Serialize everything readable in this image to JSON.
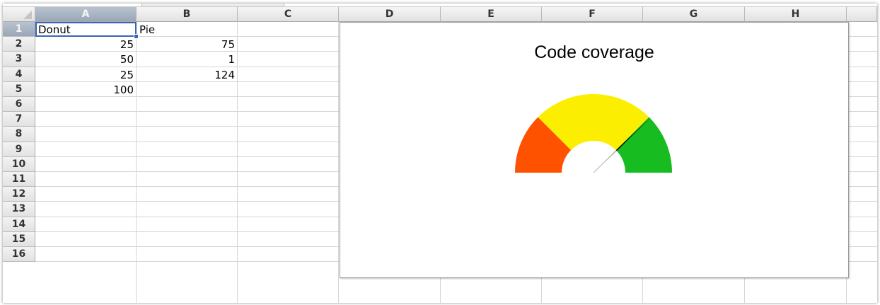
{
  "columns": [
    "A",
    "B",
    "C",
    "D",
    "E",
    "F",
    "G",
    "H"
  ],
  "rows": [
    "1",
    "2",
    "3",
    "4",
    "5",
    "6",
    "7",
    "8",
    "9",
    "10",
    "11",
    "12",
    "13",
    "14",
    "15",
    "16"
  ],
  "selected_cell": "A1",
  "cells": [
    {
      "ref": "A1",
      "value": "Donut",
      "numeric": false
    },
    {
      "ref": "B1",
      "value": "Pie",
      "numeric": false
    },
    {
      "ref": "A2",
      "value": "25",
      "numeric": true
    },
    {
      "ref": "B2",
      "value": "75",
      "numeric": true
    },
    {
      "ref": "A3",
      "value": "50",
      "numeric": true
    },
    {
      "ref": "B3",
      "value": "1",
      "numeric": true
    },
    {
      "ref": "A4",
      "value": "25",
      "numeric": true
    },
    {
      "ref": "B4",
      "value": "124",
      "numeric": true
    },
    {
      "ref": "A5",
      "value": "100",
      "numeric": true
    }
  ],
  "chart_data": {
    "type": "gauge",
    "title": "Code coverage",
    "donut": {
      "name": "Donut",
      "values": [
        25,
        50,
        25,
        100
      ],
      "colors": [
        "#FF5200",
        "#FBEE00",
        "#17BD20",
        "none"
      ]
    },
    "pie": {
      "name": "Pie",
      "values": [
        75,
        1,
        124
      ],
      "colors": [
        "none",
        "#000000",
        "none"
      ]
    },
    "needle_value": 75,
    "needle_range": 100
  }
}
